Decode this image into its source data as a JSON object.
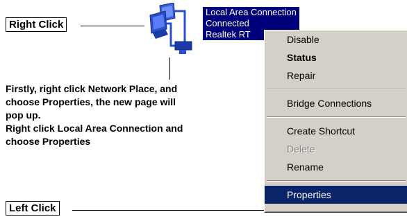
{
  "callouts": {
    "right_click": "Right Click",
    "left_click": "Left Click"
  },
  "instructions": {
    "lines": [
      "Firstly, right click Network Place, and",
      "choose Properties, the new page will",
      "pop up.",
      "Right click Local Area Connection and",
      "choose Properties"
    ]
  },
  "connection": {
    "name": "Local Area Connection",
    "status": "Connected",
    "adapter": "Realtek RT"
  },
  "icons": {
    "network": "network-connection-icon"
  },
  "context_menu": {
    "items": [
      {
        "label": "Disable"
      },
      {
        "label": "Status"
      },
      {
        "label": "Repair"
      },
      {
        "label": "Bridge Connections"
      },
      {
        "label": "Create Shortcut"
      },
      {
        "label": "Delete"
      },
      {
        "label": "Rename"
      },
      {
        "label": "Properties"
      }
    ]
  },
  "colors": {
    "highlight": "#00007b",
    "menu_selected": "#0a246a",
    "menu_bg": "#d4d0c8"
  }
}
